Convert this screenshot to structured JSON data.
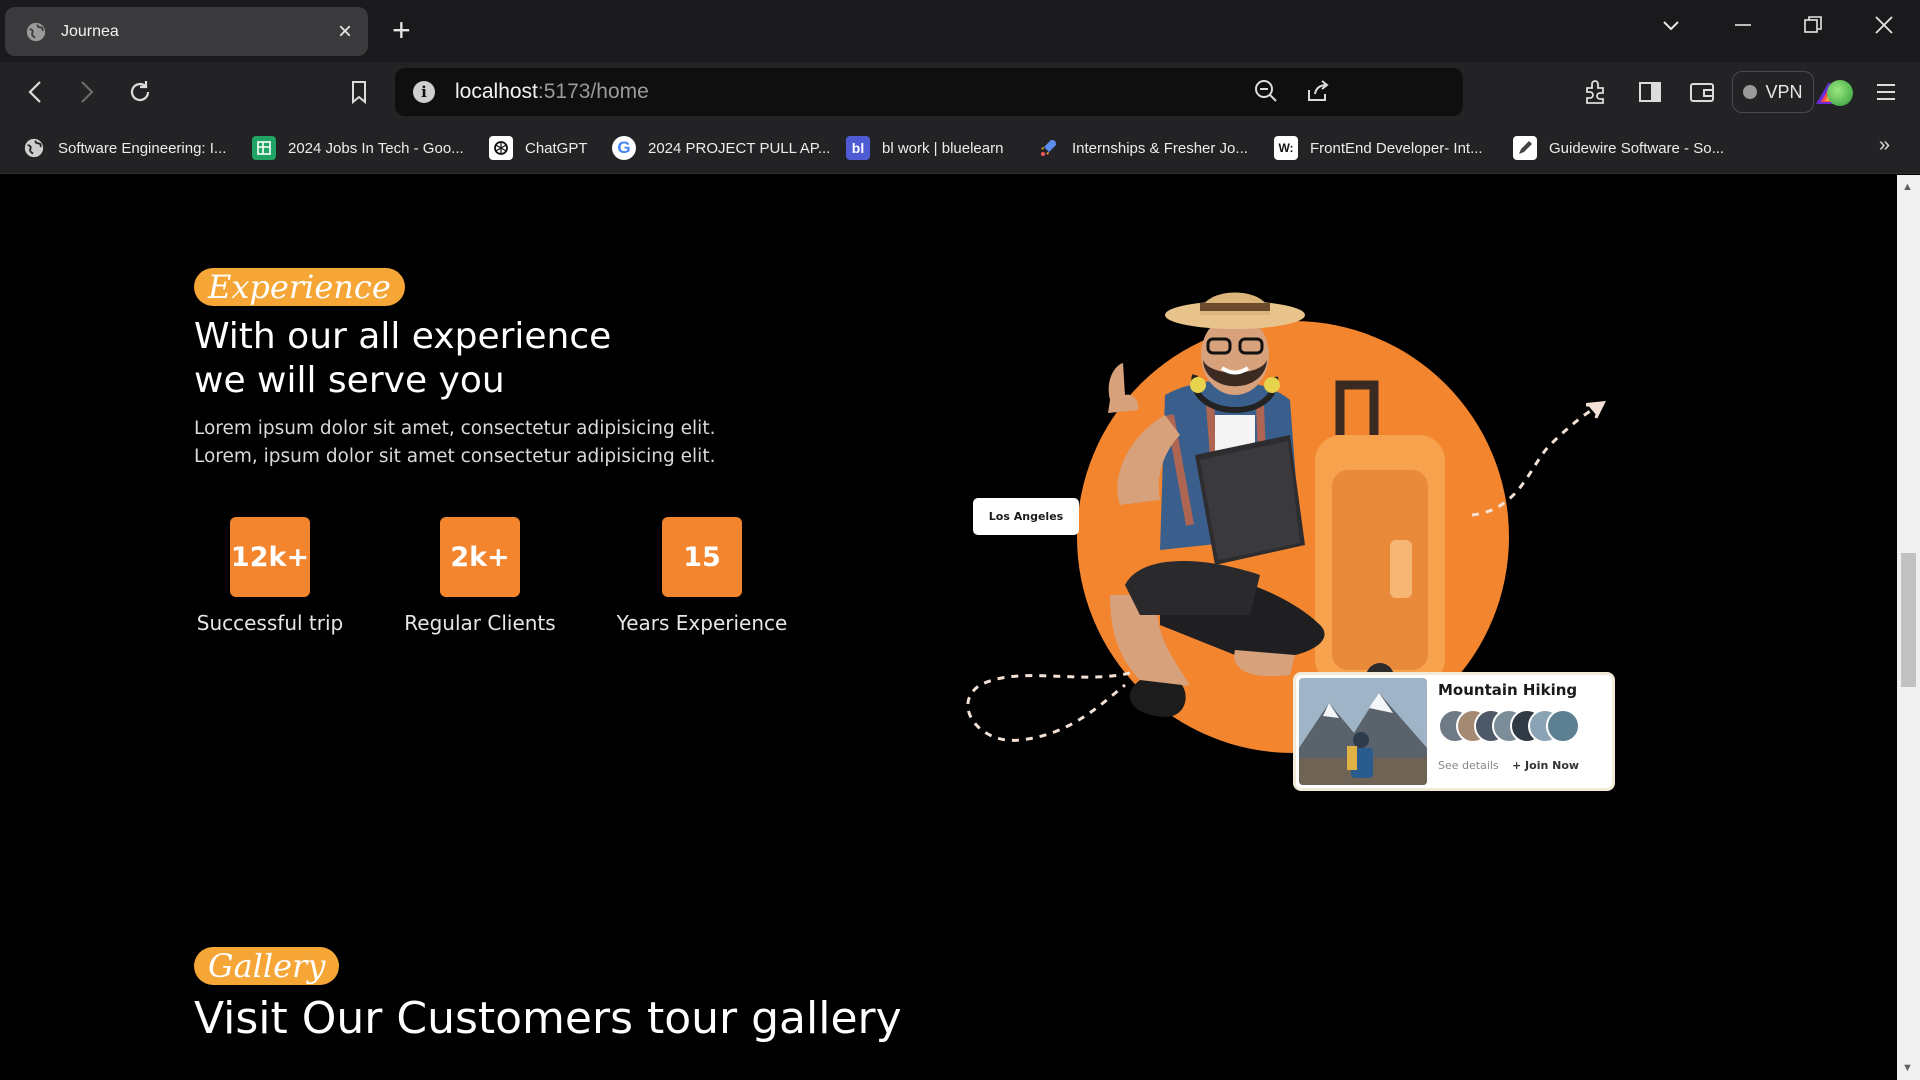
{
  "browser": {
    "tab_title": "Journea",
    "url_host": "localhost",
    "url_rest": ":5173/home",
    "vpn_label": "VPN",
    "bookmarks": [
      {
        "label": "Software Engineering: I...",
        "icon": "globe-icon"
      },
      {
        "label": "2024 Jobs In Tech - Goo...",
        "icon": "sheets-icon"
      },
      {
        "label": "ChatGPT",
        "icon": "chatgpt-icon"
      },
      {
        "label": "2024 PROJECT PULL AP...",
        "icon": "google-icon"
      },
      {
        "label": "bl work | bluelearn",
        "icon": "bluelearn-icon"
      },
      {
        "label": "Internships & Fresher Jo...",
        "icon": "rocket-icon"
      },
      {
        "label": "FrontEnd Developer- Int...",
        "icon": "wellfound-icon"
      },
      {
        "label": "Guidewire Software - So...",
        "icon": "pen-icon"
      }
    ]
  },
  "experience": {
    "badge": "Experience",
    "heading_line1": "With our all experience",
    "heading_line2": "we will serve you",
    "lede_line1": "Lorem ipsum dolor sit amet, consectetur adipisicing elit.",
    "lede_line2": "Lorem, ipsum dolor sit amet consectetur adipisicing elit.",
    "stats": [
      {
        "value": "12k+",
        "label": "Successful trip"
      },
      {
        "value": "2k+",
        "label": "Regular Clients"
      },
      {
        "value": "15",
        "label": "Years Experience"
      }
    ]
  },
  "hero": {
    "location_tag": "Los Angeles",
    "card_title": "Mountain Hiking",
    "card_see": "See details",
    "card_join": "+ Join Now"
  },
  "gallery": {
    "badge": "Gallery",
    "heading": "Visit Our Customers tour gallery"
  },
  "colors": {
    "accent_orange": "#f2852e",
    "badge_yellow": "#f5a636",
    "background": "#000000"
  }
}
